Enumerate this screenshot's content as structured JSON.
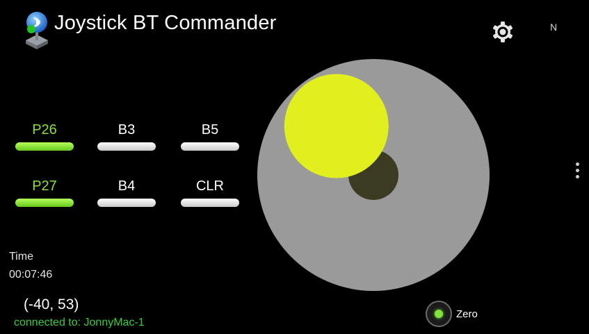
{
  "header": {
    "title": "Joystick BT Commander",
    "app_icon": "joystick-bluetooth-icon",
    "settings_icon": "gear-icon",
    "status_label": "N",
    "overflow_icon": "more-vert-icon"
  },
  "buttons": [
    {
      "label": "P26",
      "active": true
    },
    {
      "label": "B3",
      "active": false
    },
    {
      "label": "B5",
      "active": false
    },
    {
      "label": "P27",
      "active": true
    },
    {
      "label": "B4",
      "active": false
    },
    {
      "label": "CLR",
      "active": false
    }
  ],
  "time": {
    "label": "Time",
    "value": "00:07:46"
  },
  "joystick": {
    "coords_text": "(-40, 53)",
    "x": -40,
    "y": 53
  },
  "status": {
    "connected": "connected to: JonnyMac-1"
  },
  "zero": {
    "label": "Zero",
    "selected": true
  },
  "colors": {
    "background": "#000000",
    "active_green": "#7ed321",
    "connected_green": "#34cf3b",
    "knob_yellow": "#e2ef1f",
    "pad_gray": "#999999"
  }
}
